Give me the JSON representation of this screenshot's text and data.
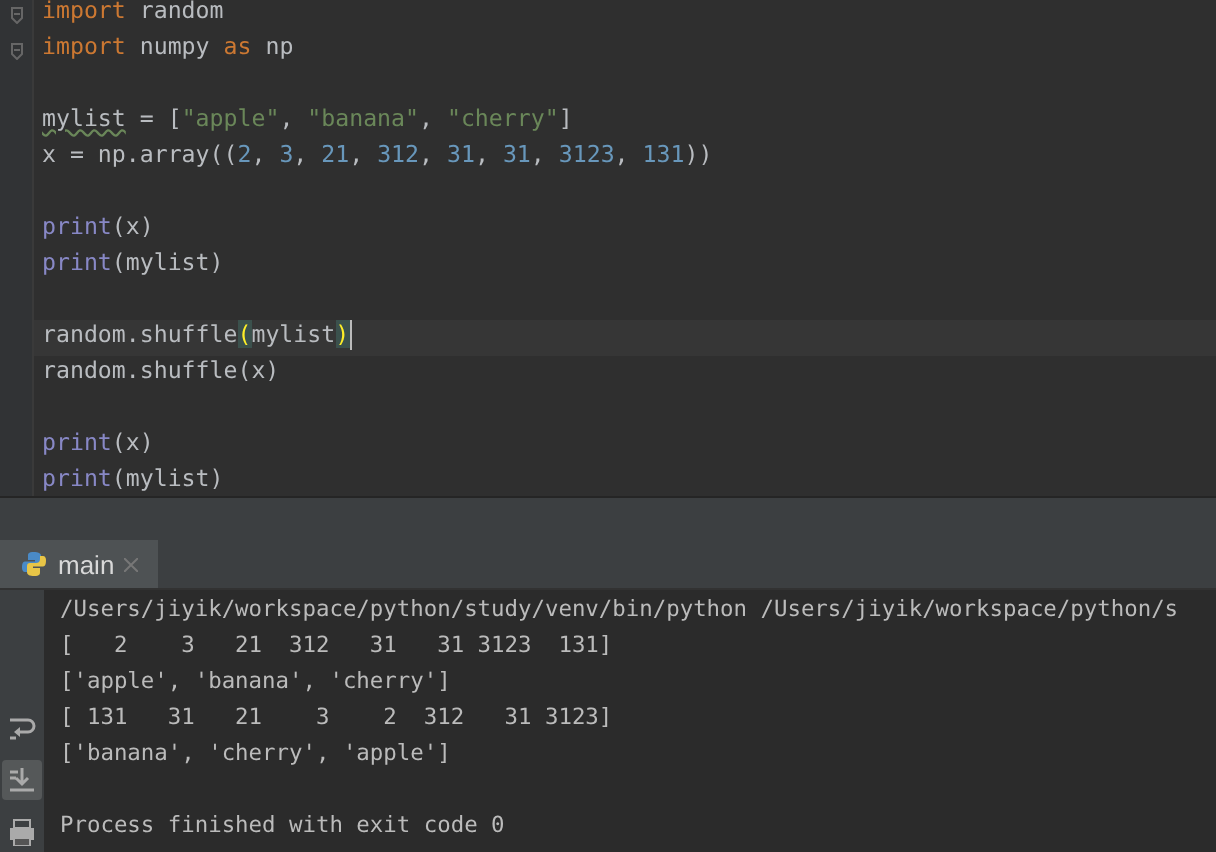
{
  "editor": {
    "lines": [
      {
        "kind": "code",
        "fold": true,
        "current": false,
        "tokens": [
          {
            "kind": "keyword",
            "text": "import"
          },
          {
            "kind": "plain",
            "text": " random"
          }
        ]
      },
      {
        "kind": "code",
        "fold": true,
        "current": false,
        "tokens": [
          {
            "kind": "keyword",
            "text": "import"
          },
          {
            "kind": "plain",
            "text": " numpy "
          },
          {
            "kind": "keyword",
            "text": "as"
          },
          {
            "kind": "plain",
            "text": " np"
          }
        ]
      },
      {
        "kind": "blank"
      },
      {
        "kind": "code",
        "fold": false,
        "current": false,
        "tokens": [
          {
            "kind": "warning",
            "text": "mylist"
          },
          {
            "kind": "plain",
            "text": " = ["
          },
          {
            "kind": "string",
            "text": "\"apple\""
          },
          {
            "kind": "plain",
            "text": ", "
          },
          {
            "kind": "string",
            "text": "\"banana\""
          },
          {
            "kind": "plain",
            "text": ", "
          },
          {
            "kind": "string",
            "text": "\"cherry\""
          },
          {
            "kind": "plain",
            "text": "]"
          }
        ]
      },
      {
        "kind": "code",
        "fold": false,
        "current": false,
        "tokens": [
          {
            "kind": "plain",
            "text": "x = np.array(("
          },
          {
            "kind": "number",
            "text": "2"
          },
          {
            "kind": "plain",
            "text": ", "
          },
          {
            "kind": "number",
            "text": "3"
          },
          {
            "kind": "plain",
            "text": ", "
          },
          {
            "kind": "number",
            "text": "21"
          },
          {
            "kind": "plain",
            "text": ", "
          },
          {
            "kind": "number",
            "text": "312"
          },
          {
            "kind": "plain",
            "text": ", "
          },
          {
            "kind": "number",
            "text": "31"
          },
          {
            "kind": "plain",
            "text": ", "
          },
          {
            "kind": "number",
            "text": "31"
          },
          {
            "kind": "plain",
            "text": ", "
          },
          {
            "kind": "number",
            "text": "3123"
          },
          {
            "kind": "plain",
            "text": ", "
          },
          {
            "kind": "number",
            "text": "131"
          },
          {
            "kind": "plain",
            "text": "))"
          }
        ]
      },
      {
        "kind": "blank"
      },
      {
        "kind": "code",
        "fold": false,
        "current": false,
        "tokens": [
          {
            "kind": "builtin",
            "text": "print"
          },
          {
            "kind": "plain",
            "text": "(x)"
          }
        ]
      },
      {
        "kind": "code",
        "fold": false,
        "current": false,
        "tokens": [
          {
            "kind": "builtin",
            "text": "print"
          },
          {
            "kind": "plain",
            "text": "(mylist)"
          }
        ]
      },
      {
        "kind": "blank"
      },
      {
        "kind": "code",
        "fold": false,
        "current": true,
        "tokens": [
          {
            "kind": "plain",
            "text": "random.shuffle"
          },
          {
            "kind": "brace",
            "text": "("
          },
          {
            "kind": "plain",
            "text": "mylist"
          },
          {
            "kind": "brace",
            "text": ")"
          }
        ]
      },
      {
        "kind": "code",
        "fold": false,
        "current": false,
        "tokens": [
          {
            "kind": "plain",
            "text": "random.shuffle(x)"
          }
        ]
      },
      {
        "kind": "blank"
      },
      {
        "kind": "code",
        "fold": false,
        "current": false,
        "tokens": [
          {
            "kind": "builtin",
            "text": "print"
          },
          {
            "kind": "plain",
            "text": "(x)"
          }
        ]
      },
      {
        "kind": "code",
        "fold": false,
        "current": false,
        "tokens": [
          {
            "kind": "builtin",
            "text": "print"
          },
          {
            "kind": "plain",
            "text": "(mylist)"
          }
        ]
      }
    ]
  },
  "run_panel": {
    "tabs": [
      {
        "label": "main",
        "selected": true
      }
    ],
    "toolbar": [
      {
        "kind": "wrap",
        "selected": false
      },
      {
        "kind": "scroll-end",
        "selected": true
      },
      {
        "kind": "print",
        "selected": false
      }
    ],
    "output": [
      {
        "kind": "stdout",
        "text": "/Users/jiyik/workspace/python/study/venv/bin/python /Users/jiyik/workspace/python/s"
      },
      {
        "kind": "stdout",
        "text": "[   2    3   21  312   31   31 3123  131]"
      },
      {
        "kind": "stdout",
        "text": "['apple', 'banana', 'cherry']"
      },
      {
        "kind": "stdout",
        "text": "[ 131   31   21    3    2  312   31 3123]"
      },
      {
        "kind": "stdout",
        "text": "['banana', 'cherry', 'apple']"
      },
      {
        "kind": "exit",
        "text": "Process finished with exit code 0"
      }
    ]
  }
}
